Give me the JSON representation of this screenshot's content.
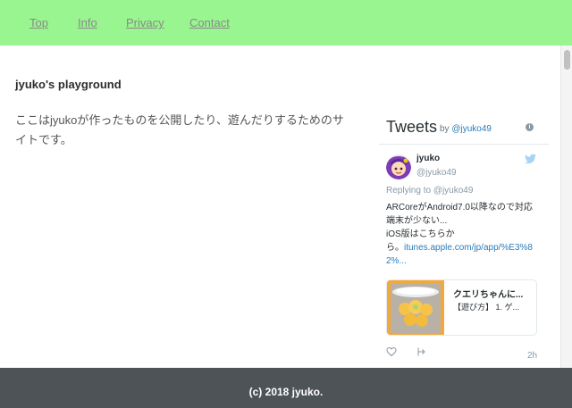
{
  "nav": {
    "items": [
      {
        "label": "Top"
      },
      {
        "label": "Info"
      },
      {
        "label": "Privacy"
      },
      {
        "label": "Contact"
      }
    ]
  },
  "main": {
    "site_title": "jyuko's playground",
    "intro_line1": "ここはjyukoが作ったものを公開したり、遊んだりするためのサ",
    "intro_line2": "イトです。"
  },
  "twitter": {
    "title": "Tweets",
    "by_label": "by",
    "by_handle": "@jyuko49",
    "info_icon": "info-icon",
    "tweet": {
      "name": "jyuko",
      "handle": "@jyuko49",
      "replying_label": "Replying to",
      "replying_handle": "@jyuko49",
      "text_line1": "ARCoreがAndroid7.0以降なので対応",
      "text_line2": "端末が少ない...",
      "text_line3": "iOS版はこちらか",
      "text_line4_prefix": "ら。",
      "link_part1": "itunes.apple.com/jp/app/%E3%8",
      "link_part2": "2%...",
      "card_title": "クエリちゃんに...",
      "card_desc": "【遊び方】 1. ゲ...",
      "time": "2h"
    },
    "colors": {
      "link": "#2b7bb9",
      "muted": "#8899a6",
      "bird": "#1da1f2"
    }
  },
  "footer": {
    "text": "(c) 2018 jyuko."
  },
  "theme": {
    "nav_bg": "#98f58f",
    "footer_bg": "#4e5358"
  }
}
